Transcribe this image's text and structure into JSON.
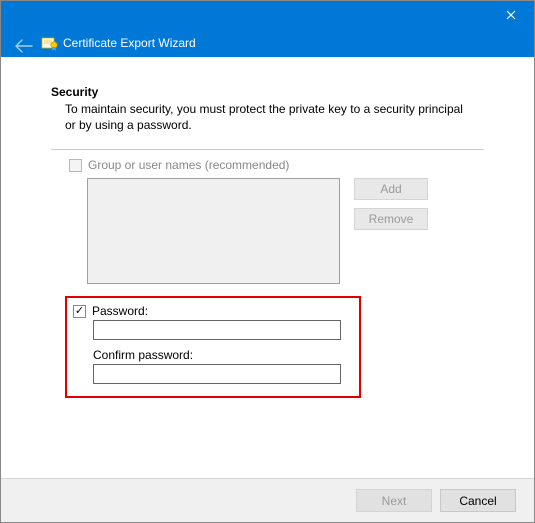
{
  "header": {
    "title": "Certificate Export Wizard"
  },
  "section": {
    "title": "Security",
    "description": "To maintain security, you must protect the private key to a security principal or by using a password."
  },
  "principals": {
    "checkbox_label": "Group or user names (recommended)",
    "checked": false,
    "add_label": "Add",
    "remove_label": "Remove"
  },
  "password": {
    "checkbox_label": "Password:",
    "checked": true,
    "value": "",
    "confirm_label": "Confirm password:",
    "confirm_value": ""
  },
  "footer": {
    "next_label": "Next",
    "cancel_label": "Cancel"
  }
}
